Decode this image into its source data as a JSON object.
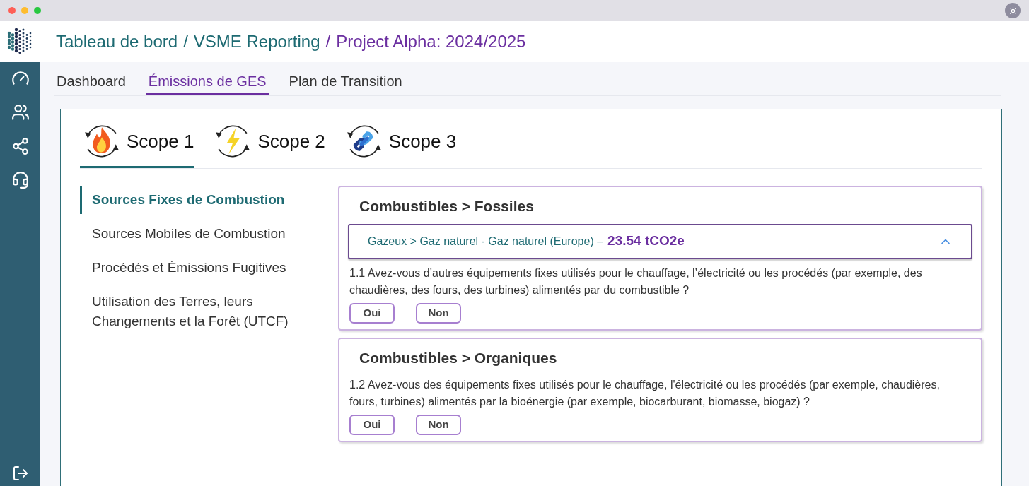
{
  "breadcrumb": {
    "separator": "/",
    "items": [
      {
        "label": "Tableau de bord",
        "selected": false
      },
      {
        "label": "VSME Reporting",
        "selected": false
      },
      {
        "label": "Project Alpha: 2024/2025",
        "selected": true
      }
    ]
  },
  "tabs": [
    {
      "label": "Dashboard",
      "selected": false
    },
    {
      "label": "Émissions de GES",
      "selected": true
    },
    {
      "label": "Plan de Transition",
      "selected": false
    }
  ],
  "scopes": [
    {
      "label": "Scope 1",
      "kind": "fire",
      "selected": true
    },
    {
      "label": "Scope 2",
      "kind": "bolt",
      "selected": false
    },
    {
      "label": "Scope 3",
      "kind": "link",
      "selected": false
    }
  ],
  "sources": [
    {
      "label": "Sources Fixes de Combustion",
      "selected": true
    },
    {
      "label": "Sources Mobiles de Combustion",
      "selected": false
    },
    {
      "label": "Procédés et Émissions Fugitives",
      "selected": false
    },
    {
      "label": "Utilisation des Terres, leurs Changements et la Forêt (UTCF)",
      "selected": false
    }
  ],
  "sections": [
    {
      "title": "Combustibles > Fossiles",
      "entry": {
        "label": "Gazeux > Gaz naturel - Gaz naturel (Europe) –",
        "value": "23.54 tCO2e",
        "expanded": true
      },
      "question": "1.1 Avez-vous d’autres équipements fixes utilisés pour le chauffage, l’électricité ou les procédés (par exemple, des chaudières, des fours, des turbines) alimentés par du combustible ?",
      "answers": [
        "Oui",
        "Non"
      ]
    },
    {
      "title": "Combustibles > Organiques",
      "question": "1.2 Avez-vous des équipements fixes utilisés pour le chauffage, l'électricité ou les procédés (par exemple, chaudières, fours, turbines) alimentés par la bioénergie (par exemple, biocarburant, biomasse, biogaz) ?",
      "answers": [
        "Oui",
        "Non"
      ]
    }
  ]
}
